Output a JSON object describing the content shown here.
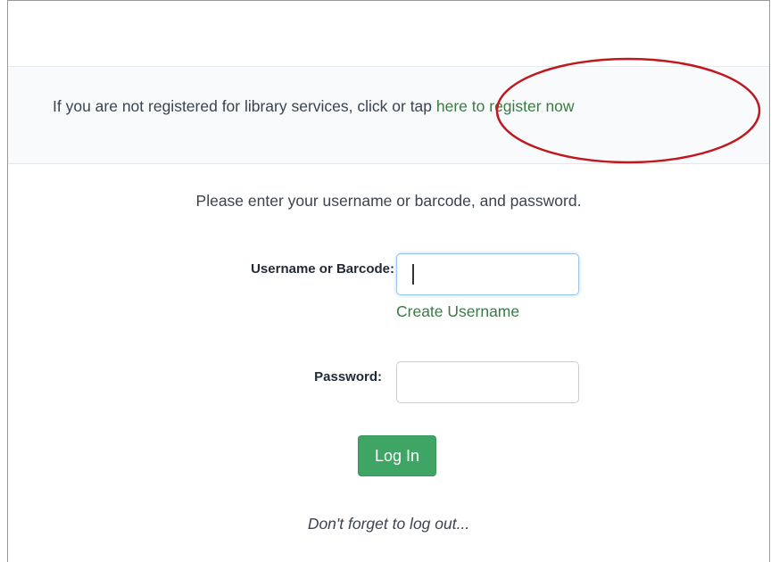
{
  "register": {
    "prefix": "If you are not registered for library services, click or tap ",
    "link_text": "here to register now"
  },
  "annotation": {
    "color": "#c0181f"
  },
  "login": {
    "prompt": "Please enter your username or barcode, and password.",
    "username_label": "Username or Barcode:",
    "username_value": "",
    "create_username_link": "Create Username",
    "password_label": "Password:",
    "password_value": "",
    "submit_label": "Log In",
    "logout_reminder": "Don't forget to log out..."
  },
  "colors": {
    "link_green": "#3b7a45",
    "button_green": "#3fa565",
    "text": "#3a4450"
  }
}
